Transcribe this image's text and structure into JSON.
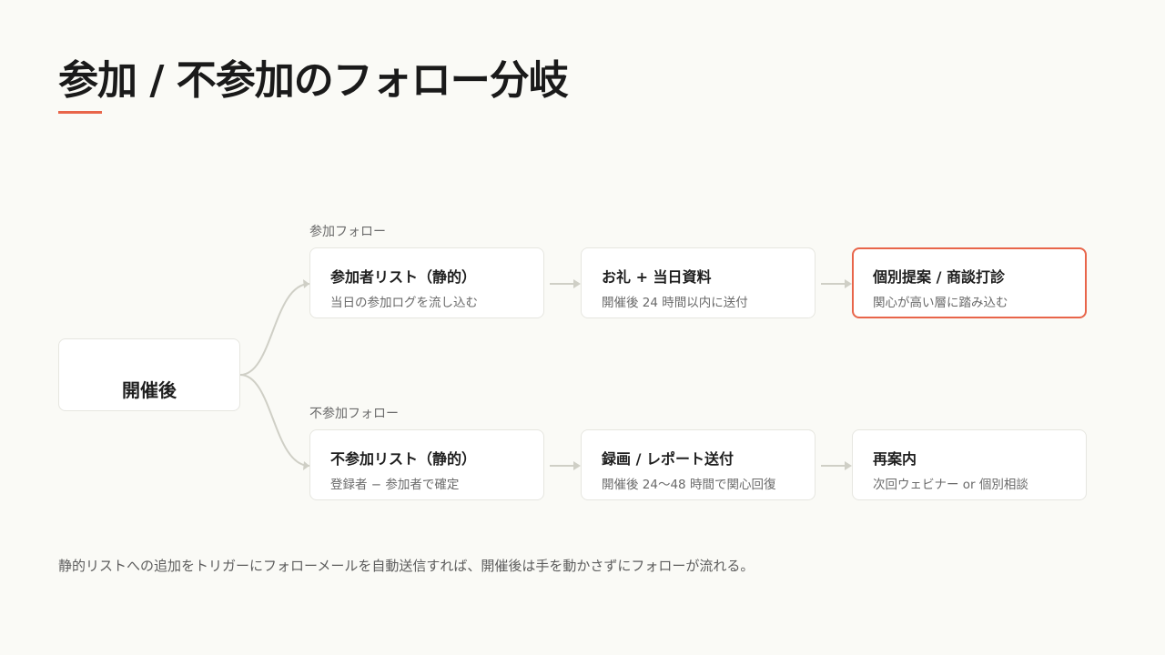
{
  "title": "参加 / 不参加のフォロー分岐",
  "root": {
    "label": "開催後"
  },
  "branches": [
    {
      "label": "参加フォロー",
      "steps": [
        {
          "title": "参加者リスト（静的）",
          "subtitle": "当日の参加ログを流し込む"
        },
        {
          "title": "お礼 + 当日資料",
          "subtitle": "開催後 24 時間以内に送付"
        },
        {
          "title": "個別提案 / 商談打診",
          "subtitle": "関心が高い層に踏み込む"
        }
      ]
    },
    {
      "label": "不参加フォロー",
      "steps": [
        {
          "title": "不参加リスト（静的）",
          "subtitle": "登録者 − 参加者で確定"
        },
        {
          "title": "録画 / レポート送付",
          "subtitle": "開催後 24〜48 時間で関心回復"
        },
        {
          "title": "再案内",
          "subtitle": "次回ウェビナー or 個別相談"
        }
      ]
    }
  ],
  "footnote": "静的リストへの追加をトリガーにフォローメールを自動送信すれば、開催後は手を動かさずにフォローが流れる。",
  "colors": {
    "accent": "#e8654a",
    "connector": "#cfcfc6",
    "background": "#fafaf6"
  }
}
